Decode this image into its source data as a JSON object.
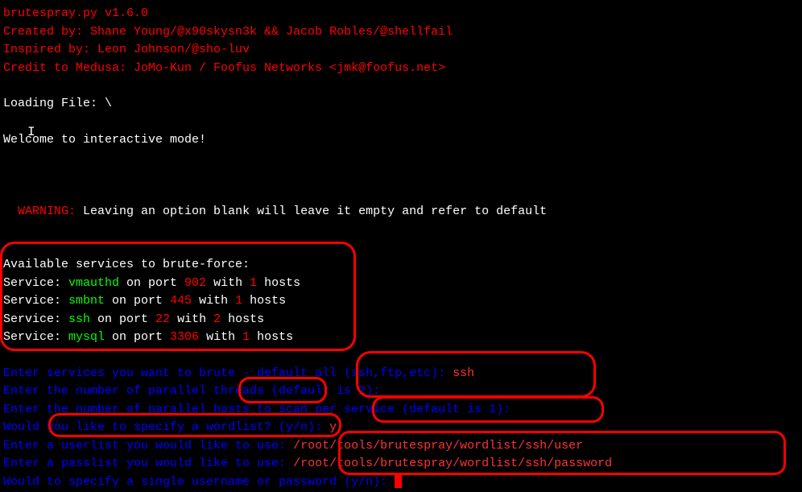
{
  "header": {
    "version": "brutespray.py v1.6.0",
    "created_by": "Created by: Shane Young/@x90skysn3k && Jacob Robles/@shellfail",
    "inspired_by": "Inspired by: Leon Johnson/@sho-luv",
    "credit": "Credit to Medusa: JoMo-Kun / Foofus Networks <jmk@foofus.net>"
  },
  "loading": "Loading File: \\",
  "welcome": "Welcome to interactive mode!",
  "warning_label": "WARNING:",
  "warning_text": " Leaving an option blank will leave it empty and refer to default",
  "services": {
    "header": "Available services to brute-force:",
    "items": [
      {
        "prefix": "Service: ",
        "name": "vmauthd",
        "mid1": " on port ",
        "port": "902",
        "mid2": " with ",
        "hosts": "1",
        "suffix": " hosts"
      },
      {
        "prefix": "Service: ",
        "name": "smbnt",
        "mid1": " on port ",
        "port": "445",
        "mid2": " with ",
        "hosts": "1",
        "suffix": " hosts"
      },
      {
        "prefix": "Service: ",
        "name": "ssh",
        "mid1": " on port ",
        "port": "22",
        "mid2": " with ",
        "hosts": "2",
        "suffix": " hosts"
      },
      {
        "prefix": "Service: ",
        "name": "mysql",
        "mid1": " on port ",
        "port": "3306",
        "mid2": " with ",
        "hosts": "1",
        "suffix": " hosts"
      }
    ]
  },
  "prompts": {
    "p1": {
      "text": "Enter services you want to brute - default all (ssh,ftp,etc): ",
      "answer": "ssh"
    },
    "p2": {
      "text": "Enter the number of parallel threads (default is 2):",
      "answer": ""
    },
    "p3": {
      "text": "Enter the number of parallel hosts to scan per service (default is 1):",
      "answer": ""
    },
    "p4": {
      "text": "Would you like to specify a wordlist? (y/n): ",
      "answer": "y"
    },
    "p5": {
      "text": "Enter a userlist you would like to use: ",
      "answer": "/root/tools/brutespray/wordlist/ssh/user"
    },
    "p6": {
      "text": "Enter a passlist you would like to use: ",
      "answer": "/root/tools/brutespray/wordlist/ssh/password"
    },
    "p7": {
      "text": "Would to specify a single username or password (y/n): ",
      "answer": ""
    }
  }
}
